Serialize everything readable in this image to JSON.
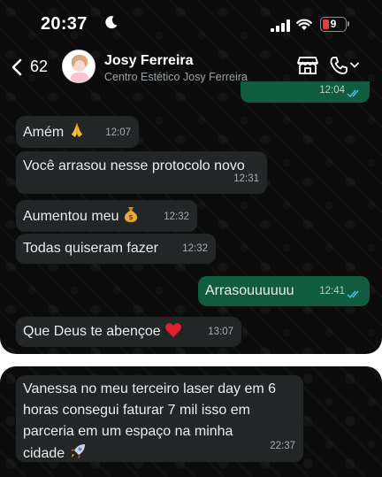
{
  "status": {
    "time": "20:37",
    "battery": "9"
  },
  "header": {
    "back_count": "62",
    "contact_name": "Josy Ferreira",
    "contact_subtitle": "Centro Estético Josy Ferreira"
  },
  "colors": {
    "outgoing_bubble": "#105c3f",
    "incoming_bubble": "#232626",
    "read_ticks": "#53bdeb",
    "battery_low": "#e2403b"
  },
  "messages": [
    {
      "direction": "out",
      "text": "",
      "time": "12:04",
      "status": "read"
    },
    {
      "direction": "in",
      "text": "Amém",
      "emoji": "folded-hands",
      "time": "12:07"
    },
    {
      "direction": "in",
      "text": "Você arrasou nesse protocolo novo",
      "time": "12:31"
    },
    {
      "direction": "in",
      "text": "Aumentou meu",
      "emoji": "money-bag",
      "time": "12:32"
    },
    {
      "direction": "in",
      "text": "Todas quiseram fazer",
      "time": "12:32"
    },
    {
      "direction": "out",
      "text": "Arrasouuuuuu",
      "time": "12:41",
      "status": "read"
    },
    {
      "direction": "in",
      "text": "Que Deus te abençoe",
      "emoji": "red-heart",
      "time": "13:07"
    }
  ],
  "second_panel": {
    "message": {
      "direction": "in",
      "lines": [
        "Vanessa no meu terceiro laser day em 6",
        "horas consegui faturar 7 mil isso em",
        "parceria em um espaço  na minha",
        "cidade"
      ],
      "emoji": "rocket",
      "time": "22:37"
    }
  }
}
